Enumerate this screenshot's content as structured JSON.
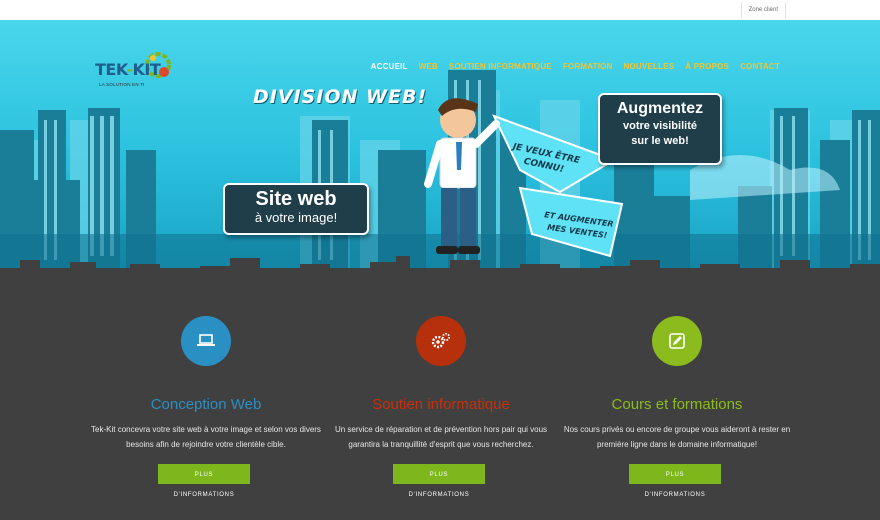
{
  "topbar": {
    "zone_client": "Zone client"
  },
  "header": {
    "logo_text_a": "TEK",
    "logo_text_b": "KIT",
    "logo_tagline": "LA SOLUTION EN TI"
  },
  "nav": {
    "items": [
      "ACCUEIL",
      "WEB",
      "SOUTIEN INFORMATIQUE",
      "FORMATION",
      "NOUVELLES",
      "À PROPOS",
      "CONTACT"
    ],
    "active_index": 0
  },
  "hero": {
    "division": "DIVISION WEB!",
    "sign_site_line1": "Site web",
    "sign_site_line2": "à votre image!",
    "sign_aug_line1": "Augmentez",
    "sign_aug_line2": "votre visibilité",
    "sign_aug_line3": "sur le web!",
    "bubble1": "JE VEUX ÊTRE CONNU!",
    "bubble2": "ET AUGMENTER MES VENTES!"
  },
  "features": [
    {
      "title": "Conception Web",
      "text": "Tek-Kit concevra votre site web à votre image et selon vos divers besoins afin de rejoindre votre clientèle cible.",
      "button": "PLUS D'INFORMATIONS",
      "color": "#2a90c4",
      "icon": "laptop-icon"
    },
    {
      "title": "Soutien informatique",
      "text": "Un service de réparation et de prévention hors pair qui vous garantira la tranquillité d'esprit que vous recherchez.",
      "button": "PLUS D'INFORMATIONS",
      "color": "#b5300b",
      "icon": "gears-icon"
    },
    {
      "title": "Cours et formations",
      "text": "Nos cours privés ou encore de groupe vous aideront à rester en première ligne dans le domaine informatique!",
      "button": "PLUS D'INFORMATIONS",
      "color": "#8bbb1c",
      "icon": "edit-icon"
    }
  ],
  "colors": {
    "nav_link": "#f4c52b",
    "button_bg": "#7eb71c",
    "section_bg": "#404040"
  }
}
